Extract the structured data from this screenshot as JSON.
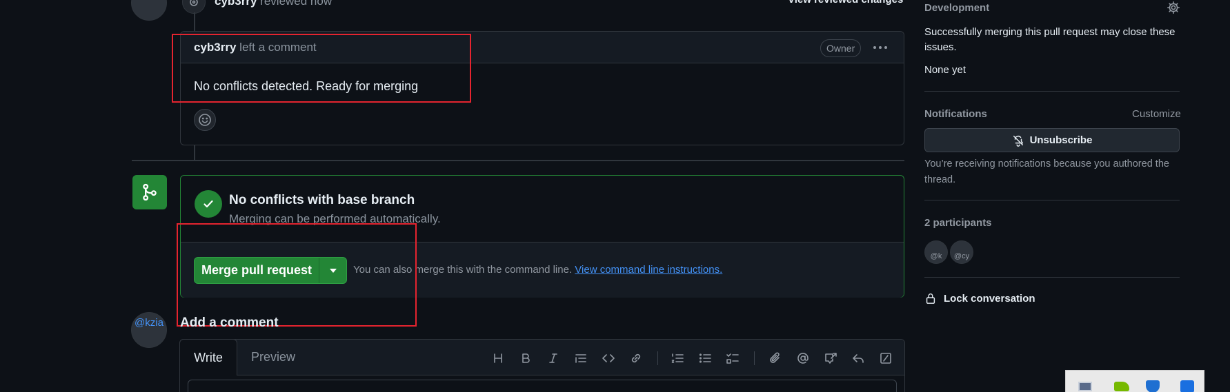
{
  "timeline": {
    "review_author": "cyb3rry",
    "review_action": "reviewed now",
    "view_changes_label": "View reviewed changes",
    "comment": {
      "author": "cyb3rry",
      "action": "left a comment",
      "badge": "Owner",
      "body": "No conflicts detected. Ready for merging"
    }
  },
  "merge": {
    "status_title": "No conflicts with base branch",
    "status_subtitle": "Merging can be performed automatically.",
    "button_label": "Merge pull request",
    "hint_text": "You can also merge this with the command line.",
    "hint_link": "View command line instructions."
  },
  "add_comment": {
    "heading": "Add a comment",
    "avatar_alt": "@kzia",
    "tabs": [
      "Write",
      "Preview"
    ]
  },
  "sidebar": {
    "development": {
      "title": "Development",
      "desc": "Successfully merging this pull request may close these issues.",
      "none": "None yet"
    },
    "notifications": {
      "title": "Notifications",
      "customize": "Customize",
      "unsubscribe": "Unsubscribe",
      "reason": "You’re receiving notifications because you authored the thread."
    },
    "participants": {
      "title": "2 participants",
      "avatar1_alt": "@k",
      "avatar2_alt": "@cy"
    },
    "lock": "Lock conversation"
  },
  "colors": {
    "accent_green": "#238636",
    "link_blue": "#4493f8",
    "highlight_red": "#e5242f"
  }
}
